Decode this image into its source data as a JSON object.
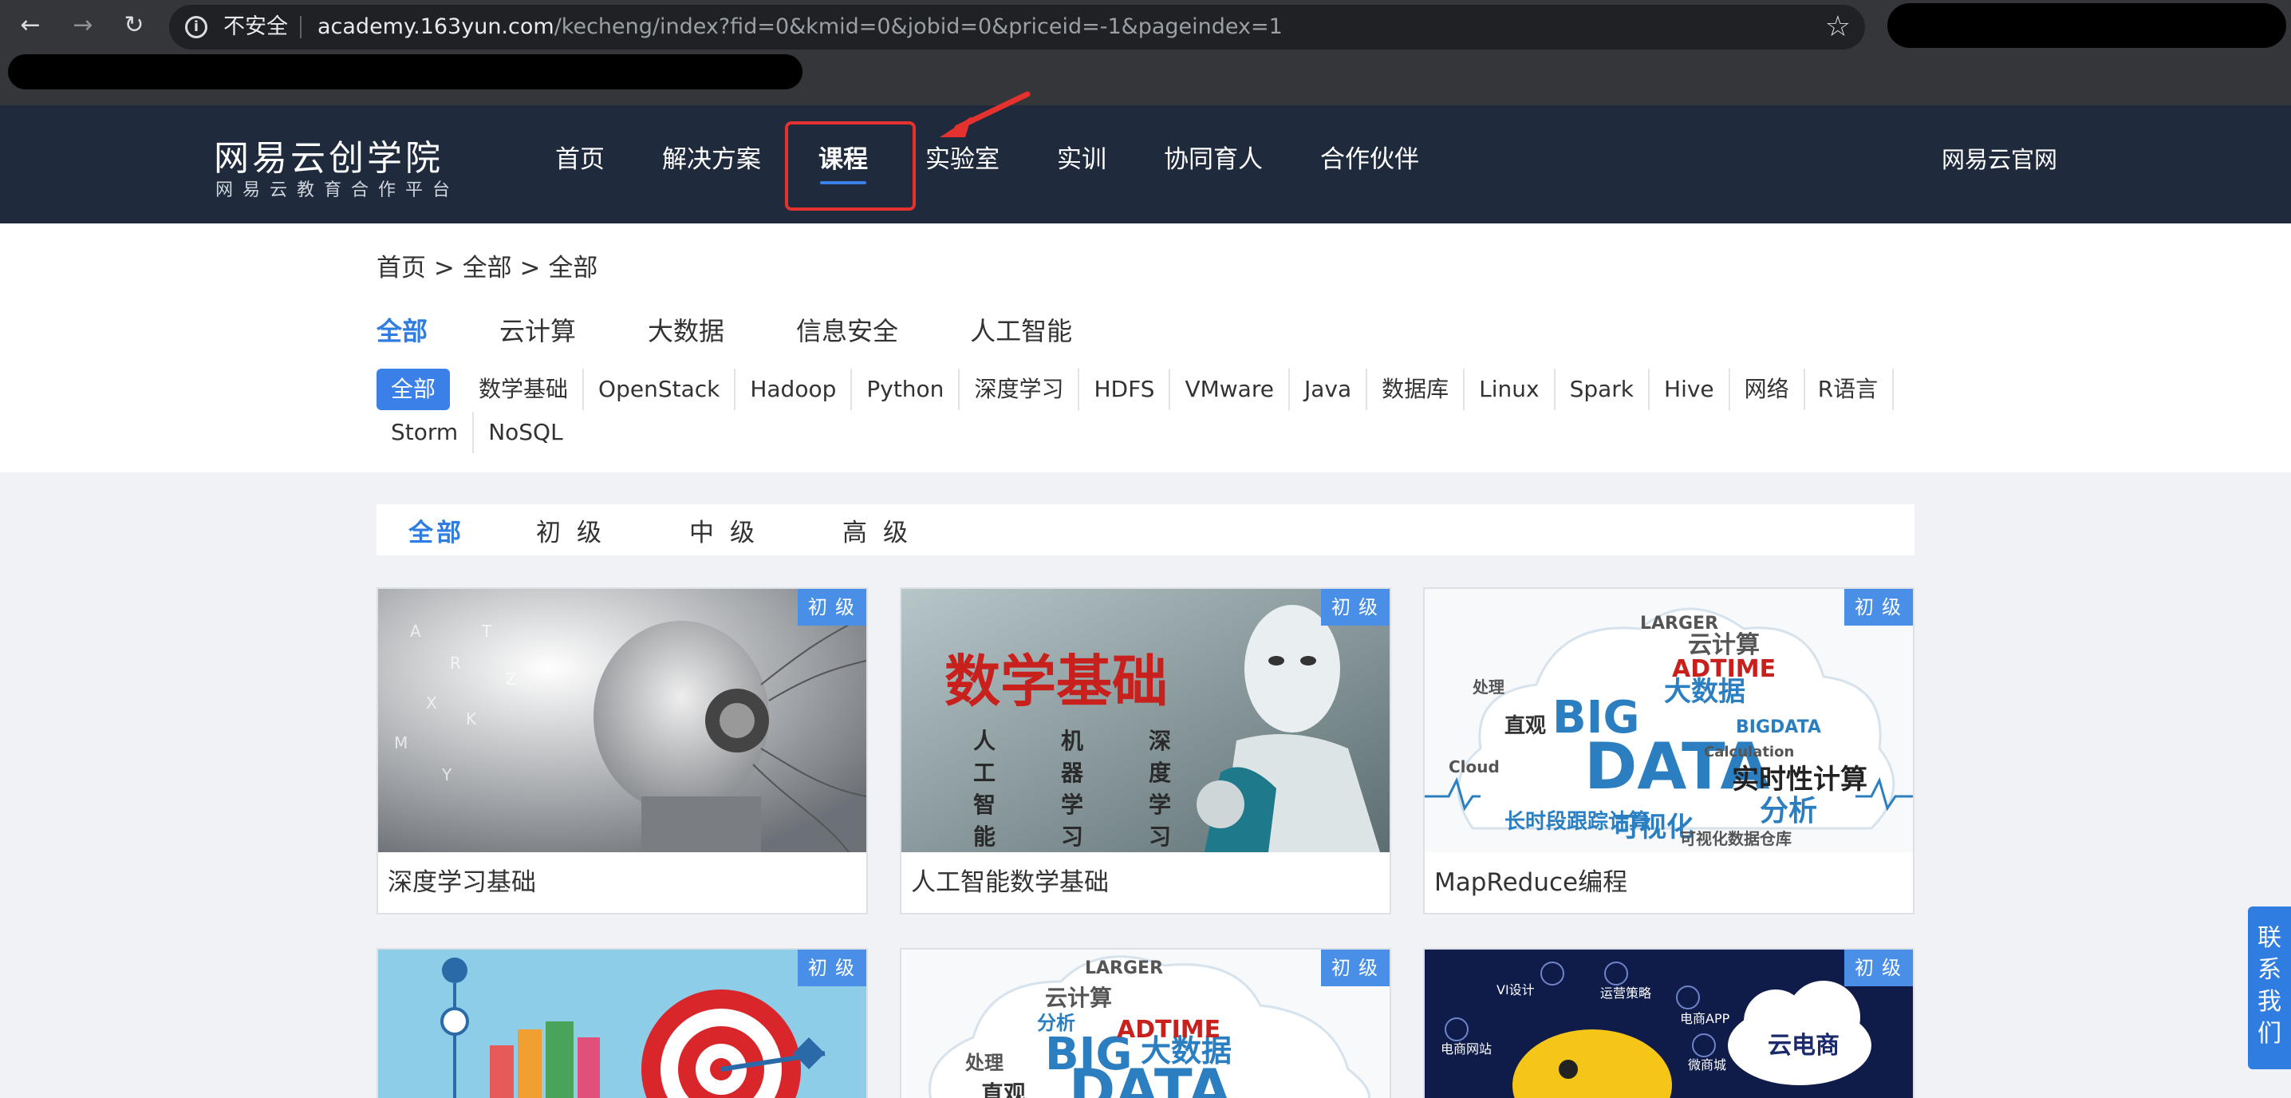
{
  "browser": {
    "back_icon": "←",
    "forward_icon": "→",
    "reload_icon": "↻",
    "security_label": "不安全",
    "url_host": "academy.163yun.com",
    "url_path": "/kecheng/index?fid=0&kmid=0&jobid=0&priceid=-1&pageindex=1",
    "star_icon": "☆"
  },
  "header": {
    "logo_title": "网易云创学院",
    "logo_subtitle": "网易云教育合作平台",
    "nav": [
      "首页",
      "解决方案",
      "课程",
      "实验室",
      "实训",
      "协同育人",
      "合作伙伴"
    ],
    "active_nav": "课程",
    "official_link": "网易云官网"
  },
  "breadcrumb": "首页 > 全部 > 全部",
  "category_tabs": [
    "全部",
    "云计算",
    "大数据",
    "信息安全",
    "人工智能"
  ],
  "tags": [
    "全部",
    "数学基础",
    "OpenStack",
    "Hadoop",
    "Python",
    "深度学习",
    "HDFS",
    "VMware",
    "Java",
    "数据库",
    "Linux",
    "Spark",
    "Hive",
    "网络",
    "R语言",
    "Storm",
    "NoSQL"
  ],
  "levels": [
    "全部",
    "初级",
    "中级",
    "高级"
  ],
  "cards": [
    {
      "title": "深度学习基础",
      "level": "初级"
    },
    {
      "title": "人工智能数学基础",
      "level": "初级",
      "image_text": "数学基础",
      "image_cols": [
        "人工智能",
        "机器学习",
        "深度学习"
      ]
    },
    {
      "title": "MapReduce编程",
      "level": "初级",
      "image_words": [
        "BIG",
        "DATA",
        "大数据",
        "ADTIME",
        "分析",
        "直观",
        "可视化",
        "实时性计算",
        "LARGER",
        "云计算",
        "BIGDATA",
        "处理",
        "长时段跟踪计算",
        "可视化数据仓库",
        "Calculation",
        "Cloud"
      ]
    },
    {
      "title": "",
      "level": "初级"
    },
    {
      "title": "",
      "level": "初级",
      "image_words": [
        "BIG",
        "DATA",
        "大数据",
        "ADTIME",
        "分析",
        "直观",
        "LARGER",
        "云计算",
        "处理"
      ]
    },
    {
      "title": "",
      "level": "初级",
      "image_words": [
        "VI设计",
        "运营策略",
        "电商APP",
        "电商网站",
        "微商城",
        "云电商"
      ]
    }
  ],
  "contact": "联系我们",
  "colors": {
    "accent": "#2f7de1",
    "header_bg": "#1f2a3c",
    "badge": "#4a8fe7",
    "highlight": "#e6322f"
  }
}
